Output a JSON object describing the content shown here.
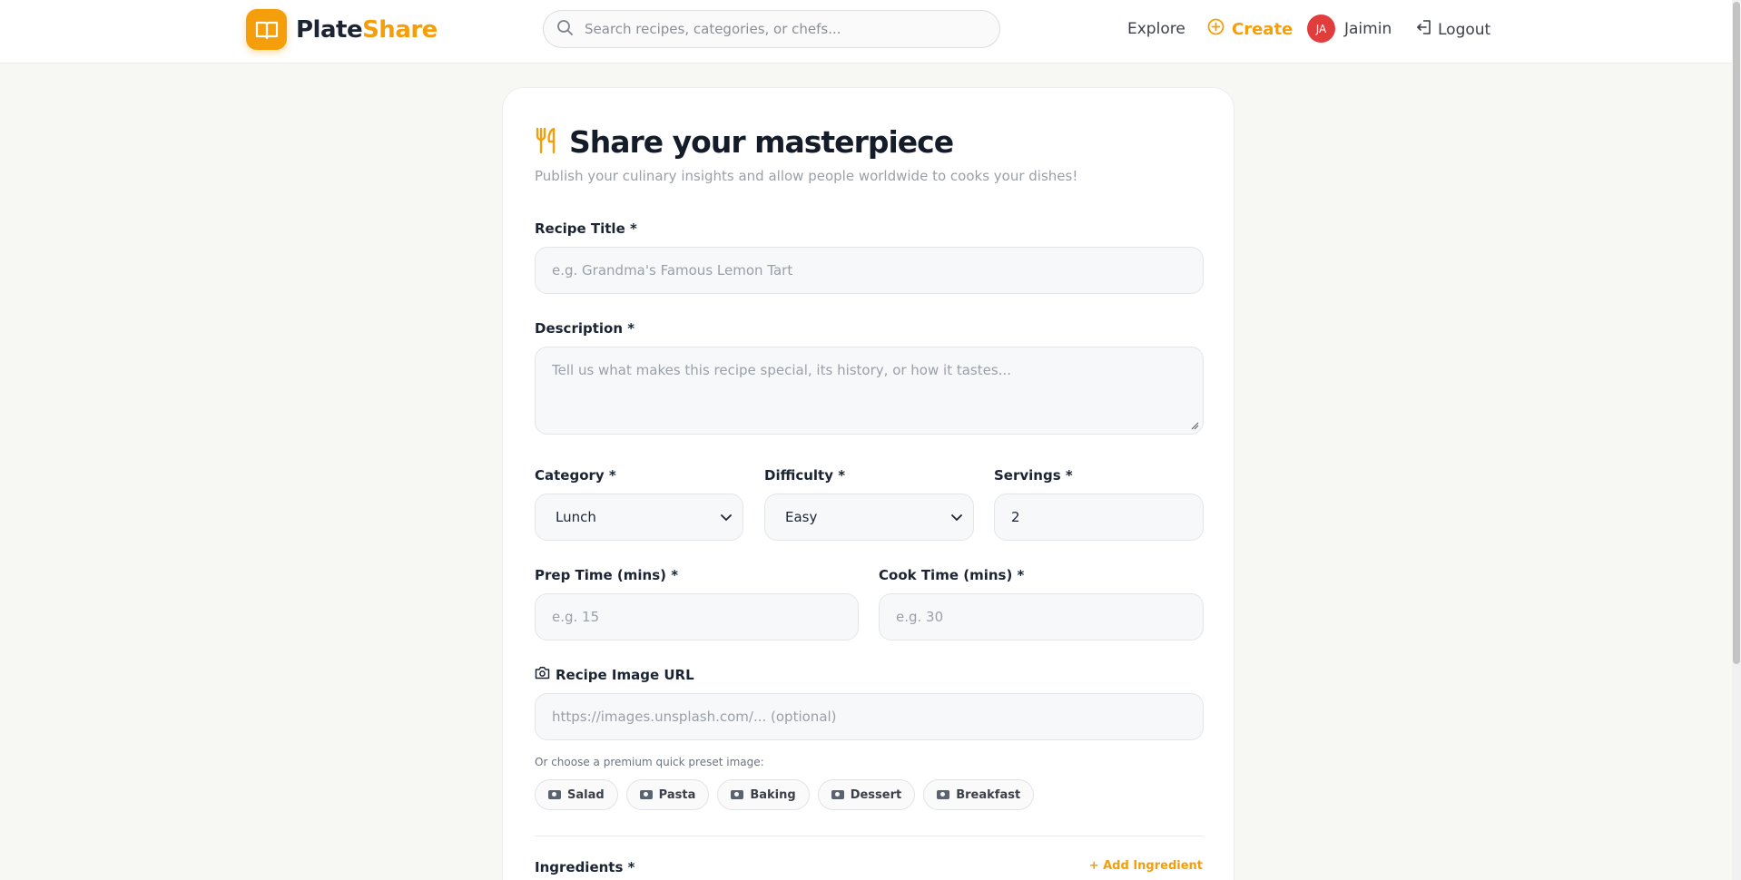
{
  "brand": {
    "name_part1": "Plate",
    "name_part2": "Share"
  },
  "search": {
    "placeholder": "Search recipes, categories, or chefs..."
  },
  "nav": {
    "explore": "Explore",
    "create": "Create",
    "user_initials": "JA",
    "user_name": "Jaimin",
    "logout": "Logout"
  },
  "form": {
    "title": "Share your masterpiece",
    "subtitle": "Publish your culinary insights and allow people worldwide to cooks your dishes!",
    "recipe_title": {
      "label": "Recipe Title *",
      "placeholder": "e.g. Grandma's Famous Lemon Tart",
      "value": ""
    },
    "description": {
      "label": "Description *",
      "placeholder": "Tell us what makes this recipe special, its history, or how it tastes...",
      "value": ""
    },
    "category": {
      "label": "Category *",
      "value": "Lunch"
    },
    "difficulty": {
      "label": "Difficulty *",
      "value": "Easy"
    },
    "servings": {
      "label": "Servings *",
      "value": "2"
    },
    "prep_time": {
      "label": "Prep Time (mins) *",
      "placeholder": "e.g. 15",
      "value": ""
    },
    "cook_time": {
      "label": "Cook Time (mins) *",
      "placeholder": "e.g. 30",
      "value": ""
    },
    "image_url": {
      "label": "Recipe Image URL",
      "placeholder": "https://images.unsplash.com/... (optional)",
      "value": ""
    },
    "preset_note": "Or choose a premium quick preset image:",
    "presets": [
      "Salad",
      "Pasta",
      "Baking",
      "Dessert",
      "Breakfast"
    ],
    "ingredients": {
      "label": "Ingredients *",
      "add_label": "+ Add Ingredient"
    }
  },
  "colors": {
    "accent": "#f59e0b",
    "avatar": "#e23d3d",
    "text": "#1c2433"
  },
  "icons": [
    "book-icon",
    "search-icon",
    "plus-circle-icon",
    "logout-icon",
    "utensils-icon",
    "camera-icon",
    "chevron-down-icon"
  ]
}
